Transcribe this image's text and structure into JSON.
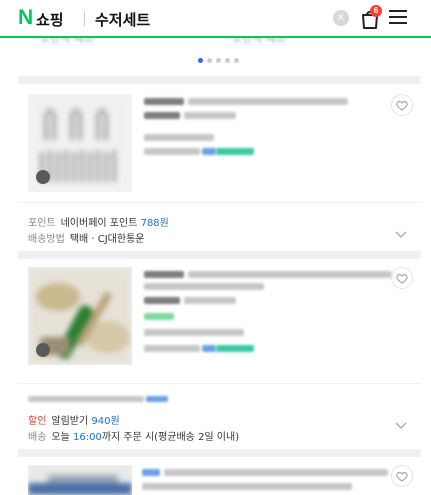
{
  "header": {
    "logo_mark": "N",
    "logo_text": "쇼핑",
    "query": "수저세트",
    "cart_count": "6",
    "clear_glyph": "×"
  },
  "carousel": {
    "peek_left": "노란색 세트",
    "peek_right": "노란색 세트",
    "dots_total": 5,
    "dots_active_index": 0
  },
  "products": [
    {
      "points_label": "포인트",
      "points_text": "네이버페이 포인트",
      "points_value": "788원",
      "shipping_label": "배송방법",
      "shipping_text": "택배 · CJ대한통운"
    },
    {
      "discount_label": "할인",
      "discount_text": "알림받기",
      "discount_value": "940원",
      "delivery_label": "배송",
      "delivery_prefix": "오늘",
      "delivery_time": "16:00",
      "delivery_suffix": "까지 주문 시(평균배송 2일 이내)"
    }
  ],
  "colors": {
    "brand": "#03c75a",
    "link": "#1a6ed8",
    "badge": "#ff3b30",
    "divider": "#eef0f3"
  },
  "icons": [
    "clear-icon",
    "cart-icon",
    "menu-icon",
    "wish-icon",
    "chevron-down-icon"
  ]
}
